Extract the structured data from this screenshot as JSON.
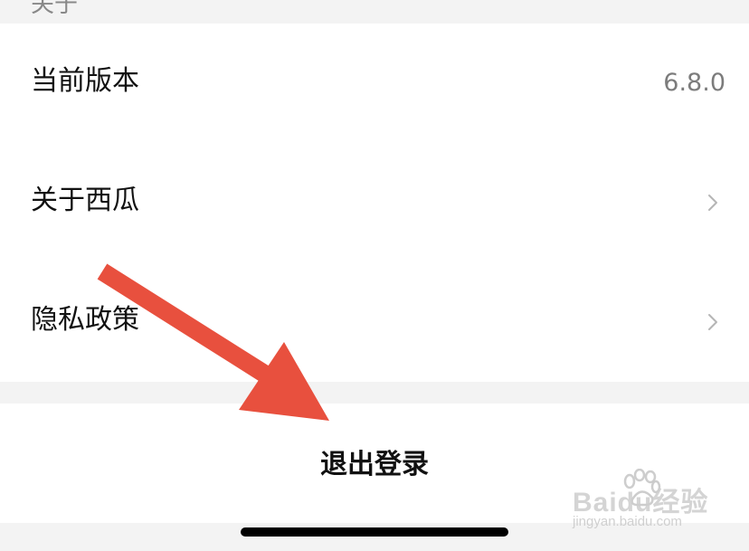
{
  "section": {
    "title": "关于"
  },
  "settings": {
    "items": [
      {
        "label": "当前版本",
        "value": "6.8.0"
      },
      {
        "label": "关于西瓜"
      },
      {
        "label": "隐私政策"
      }
    ]
  },
  "logout": {
    "label": "退出登录"
  },
  "watermark": {
    "brand": "Baidu经验",
    "url": "jingyan.baidu.com"
  },
  "colors": {
    "arrow": "#e8503e",
    "background": "#f3f3f3",
    "card": "#ffffff"
  }
}
